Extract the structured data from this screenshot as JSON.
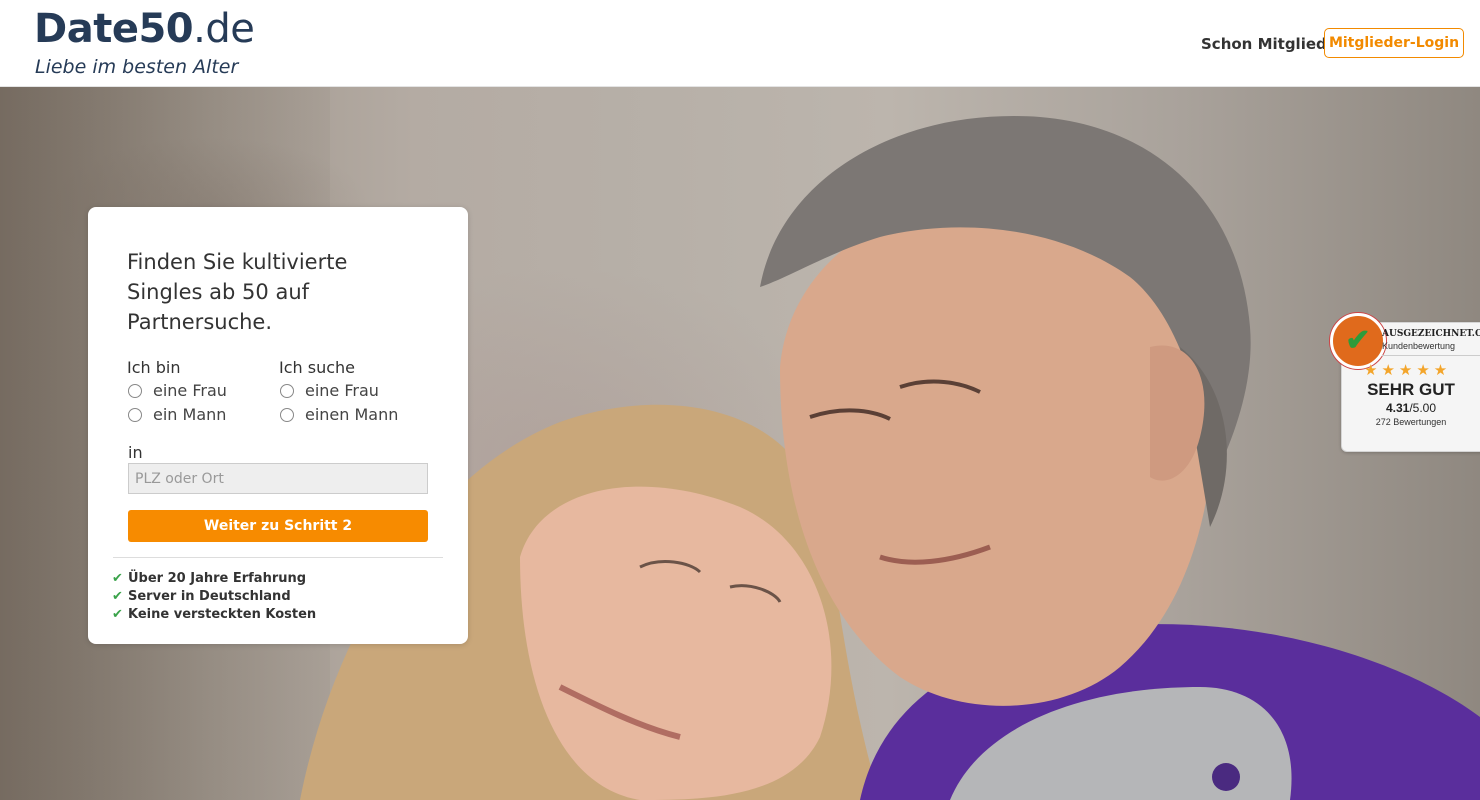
{
  "header": {
    "logo_bold": "Date50",
    "logo_tld": ".de",
    "tagline": "Liebe im besten Alter",
    "member_question": "Schon Mitglied?",
    "login_label": "Mitglieder-Login"
  },
  "signup": {
    "heading": "Finden Sie kultivierte Singles ab 50 auf Partnersuche.",
    "i_am_label": "Ich bin",
    "i_am_options": [
      "eine Frau",
      "ein Mann"
    ],
    "seeking_label": "Ich suche",
    "seeking_options": [
      "eine Frau",
      "einen Mann"
    ],
    "location_label": "in",
    "location_placeholder": "PLZ oder Ort",
    "submit_label": "Weiter zu Schritt 2",
    "features": [
      "Über 20 Jahre Erfahrung",
      "Server in Deutschland",
      "Keine versteckten Kosten"
    ]
  },
  "rating_badge": {
    "brand": "AUSGEZEICHNET.ORG",
    "subtitle": "Kundenbewertung",
    "stars": "★★★★★",
    "rating_word": "SEHR GUT",
    "score": "4.31",
    "score_max": "/5.00",
    "review_count": "272 Bewertungen"
  },
  "colors": {
    "accent": "#f78b00",
    "logo": "#263b57",
    "check": "#3aa34a"
  }
}
